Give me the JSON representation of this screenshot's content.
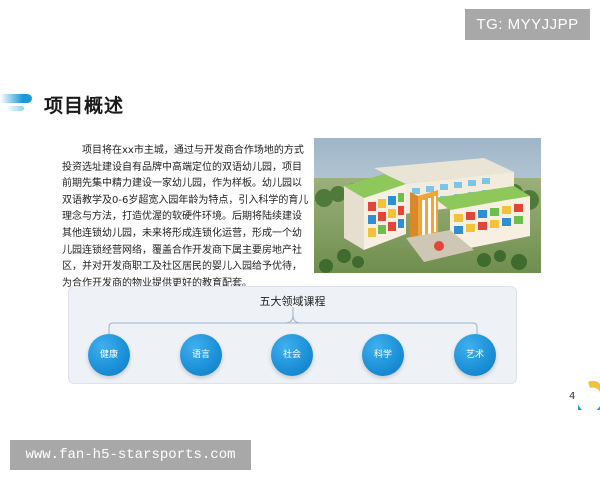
{
  "badge": {
    "text": "TG: MYYJJPP"
  },
  "page": {
    "title": "项目概述",
    "page_number": "4"
  },
  "body": {
    "lines": [
      "项目将在xx市主城，通过与开发商合作场地的方式",
      "投资选址建设自有品牌中高端定位的双语幼儿园，项目",
      "前期先集中精力建设一家幼儿园，作为样板。幼儿园以",
      "双语教学及0-6岁超宽入园年龄为特点，引入科学的育儿",
      "理念与方法，打造优渥的软硬件环境。后期将陆续建设",
      "其他连锁幼儿园，未来将形成连锁化运营，形成一个幼",
      "儿园连锁经营网络，覆盖合作开发商下属主要房地产社",
      "区，并对开发商职工及社区居民的婴儿入园给予优待，",
      "为合作开发商的物业提供更好的教育配套。"
    ]
  },
  "courses": {
    "title": "五大领域课程",
    "items": [
      "健康",
      "语言",
      "社会",
      "科学",
      "艺术"
    ],
    "color": "#1b8fd6"
  },
  "footer": {
    "watermark": "www.fan-h5-starsports.com"
  },
  "colors": {
    "accent": "#1d9bd8",
    "panel_bg": "#eef1f5",
    "badge_bg": "#a8a8a8"
  }
}
